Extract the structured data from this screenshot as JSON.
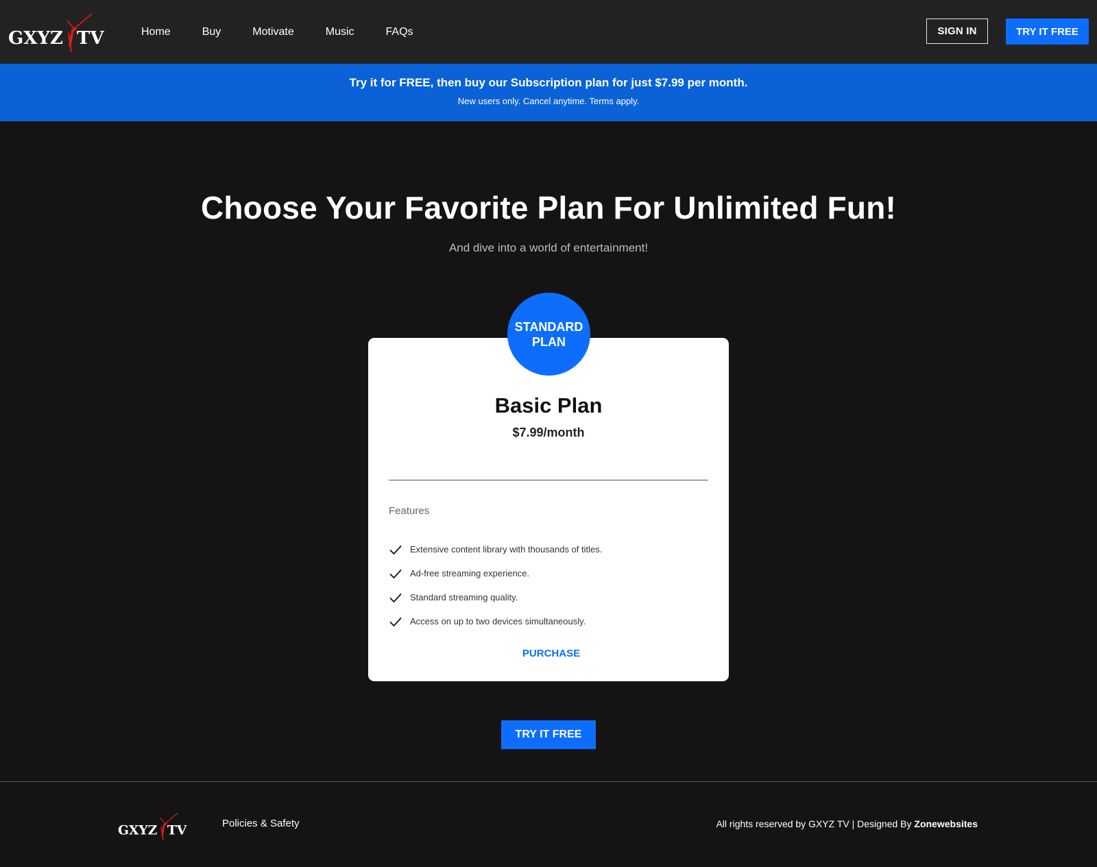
{
  "header": {
    "logo_text": "GXYZ TV",
    "nav": [
      "Home",
      "Buy",
      "Motivate",
      "Music",
      "FAQs"
    ],
    "sign_in_label": "SIGN IN",
    "try_free_label": "TRY IT FREE"
  },
  "banner": {
    "headline": "Try it for FREE, then buy our Subscription plan for just $7.99 per month.",
    "subtext": "New users only. Cancel anytime. Terms apply."
  },
  "hero": {
    "title": "Choose Your Favorite Plan For Unlimited Fun!",
    "subtitle": "And dive into a world of entertainment!"
  },
  "plan": {
    "badge_line1": "STANDARD",
    "badge_line2": "PLAN",
    "name": "Basic Plan",
    "price": "$7.99/month",
    "features_heading": "Features",
    "features": [
      "Extensive content library with thousands of titles.",
      "Ad-free streaming experience.",
      "Standard streaming quality.",
      "Access on up to two devices simultaneously."
    ],
    "purchase_label": "PURCHASE"
  },
  "cta": {
    "try_free_label": "TRY IT FREE"
  },
  "footer": {
    "logo_text": "GXYZ TV",
    "link": "Policies & Safety",
    "copyright_prefix": "All rights reserved by GXYZ TV | Designed By ",
    "designer": "Zonewebsites"
  },
  "colors": {
    "accent": "#0d6efd",
    "banner": "#0a62d6",
    "header_bg": "#222223",
    "page_bg": "#141415",
    "logo_accent": "#e01b1b"
  },
  "icons": {
    "feature_check": "check-icon"
  }
}
